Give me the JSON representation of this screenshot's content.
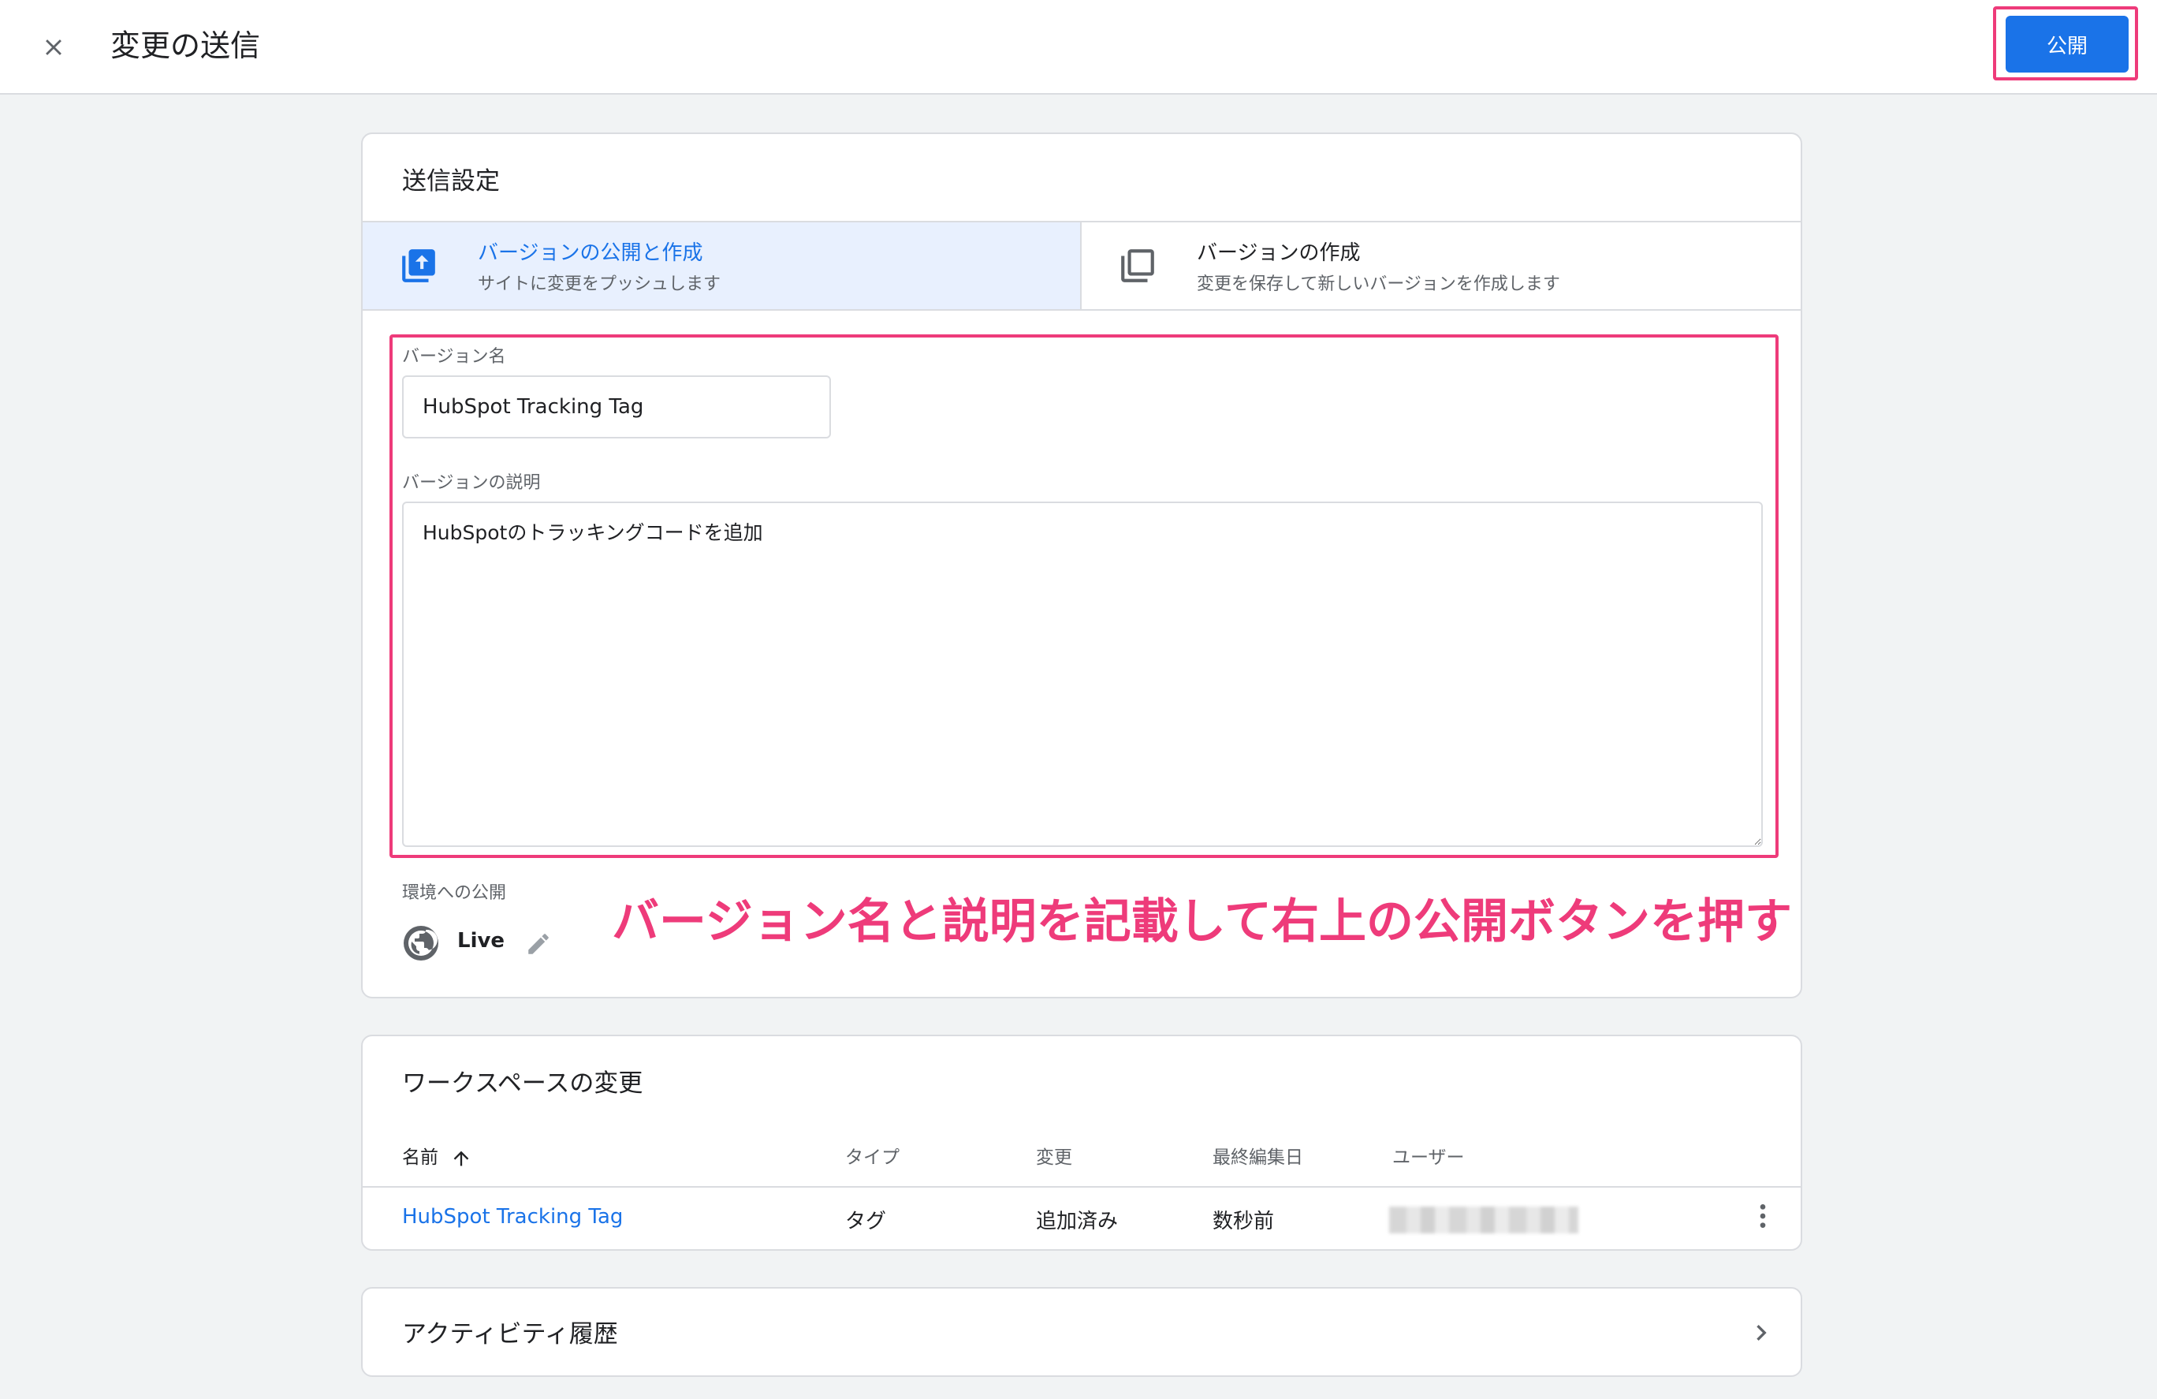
{
  "header": {
    "title": "変更の送信",
    "publish_label": "公開"
  },
  "submission": {
    "title": "送信設定",
    "options": [
      {
        "title": "バージョンの公開と作成",
        "subtitle": "サイトに変更をプッシュします",
        "selected": true,
        "icon": "publish-upload-icon"
      },
      {
        "title": "バージョンの作成",
        "subtitle": "変更を保存して新しいバージョンを作成します",
        "selected": false,
        "icon": "copy-version-icon"
      }
    ],
    "version_name_label": "バージョン名",
    "version_name_value": "HubSpot Tracking Tag",
    "version_desc_label": "バージョンの説明",
    "version_desc_value": "HubSpotのトラッキングコードを追加",
    "env_label": "環境への公開",
    "env_name": "Live"
  },
  "annotation": "バージョン名と説明を記載して右上の公開ボタンを押す",
  "workspace": {
    "title": "ワークスペースの変更",
    "columns": [
      "名前",
      "タイプ",
      "変更",
      "最終編集日",
      "ユーザー"
    ],
    "rows": [
      {
        "name": "HubSpot Tracking Tag",
        "type": "タグ",
        "change": "追加済み",
        "edited": "数秒前"
      }
    ]
  },
  "activity": {
    "title": "アクティビティ履歴"
  },
  "colors": {
    "accent": "#1a73e8",
    "highlight": "#ee3b7a",
    "selected_bg": "#e8f0fe"
  }
}
